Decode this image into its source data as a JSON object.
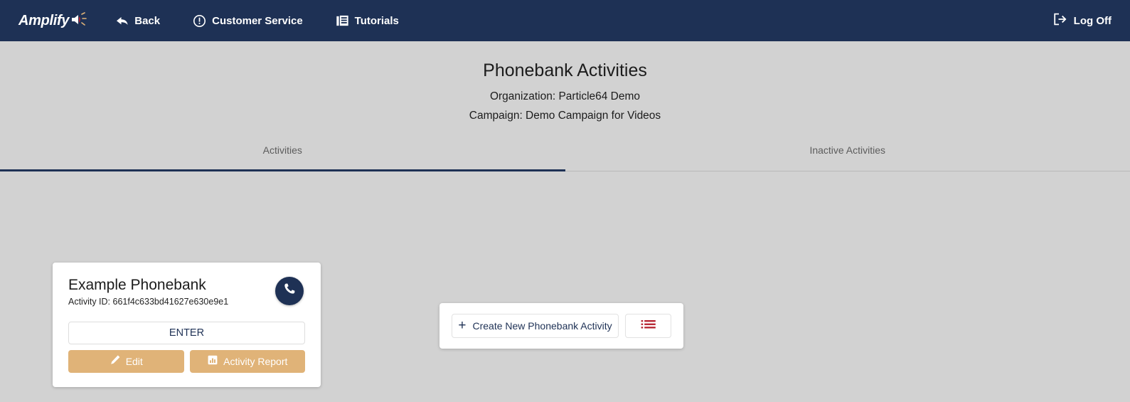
{
  "topnav": {
    "logo_text": "Amplify",
    "logo_icon": "megaphone-icon",
    "items": [
      {
        "label": "Back",
        "icon": "back-arrow-icon"
      },
      {
        "label": "Customer Service",
        "icon": "exclamation-circle-icon"
      },
      {
        "label": "Tutorials",
        "icon": "book-icon"
      }
    ],
    "logoff": {
      "label": "Log Off",
      "icon": "logout-icon"
    }
  },
  "page": {
    "title": "Phonebank Activities",
    "organization": "Organization: Particle64 Demo",
    "campaign": "Campaign: Demo Campaign for Videos"
  },
  "tabs": [
    {
      "label": "Activities",
      "active": true
    },
    {
      "label": "Inactive Activities",
      "active": false
    }
  ],
  "activity_card": {
    "title": "Example Phonebank",
    "activity_id": "Activity ID: 661f4c633bd41627e630e9e1",
    "phone_icon": "phone-icon",
    "enter_label": "ENTER",
    "edit_label": "Edit",
    "edit_icon": "pencil-icon",
    "report_label": "Activity Report",
    "report_icon": "bar-chart-icon"
  },
  "create_panel": {
    "create_label": "Create New Phonebank Activity",
    "create_icon": "plus-icon",
    "list_icon": "list-icon"
  },
  "colors": {
    "navy": "#1e3155",
    "tan": "#e0b378",
    "page_background": "#d2d2d2",
    "red_accent": "#b5202e",
    "card_white": "#ffffff"
  }
}
